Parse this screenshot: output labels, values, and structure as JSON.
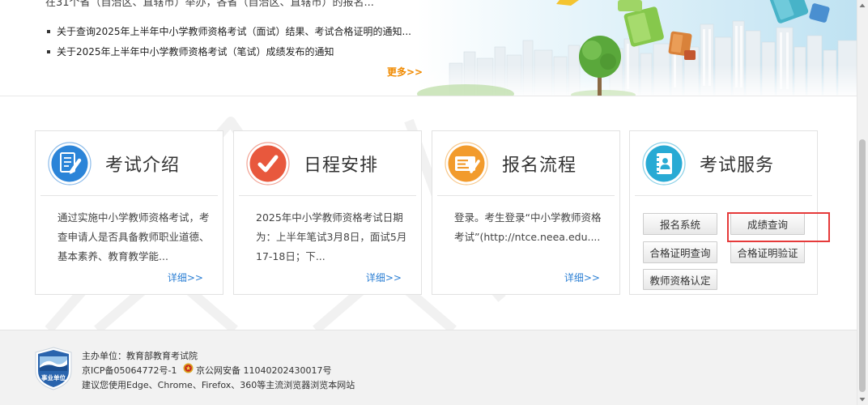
{
  "header": {
    "intro_text": "在31个省（自治区、直辖市）举办，各省（自治区、直辖市）的报名...",
    "news": [
      "关于查询2025年上半年中小学教师资格考试（面试）结果、考试合格证明的通知...",
      "关于2025年上半年中小学教师资格考试（笔试）成绩发布的通知"
    ],
    "more_label": "更多>>"
  },
  "cards": [
    {
      "title": "考试介绍",
      "icon": "document-pencil-icon",
      "color": "#2b84d8",
      "lines": [
        "通过实施中小学教师资格考试，考",
        "查申请人是否具备教师职业道德、",
        "基本素养、教育教学能..."
      ],
      "detail_label": "详细>>"
    },
    {
      "title": "日程安排",
      "icon": "checkmark-icon",
      "color": "#e8583d",
      "lines": [
        "2025年中小学教师资格考试日期",
        "为：上半年笔试3月8日，面试5月",
        "17-18日；下..."
      ],
      "detail_label": "详细>>"
    },
    {
      "title": "报名流程",
      "icon": "registration-form-icon",
      "color": "#f29b2c",
      "lines": [
        "登录。考生登录“中小学教师资格",
        "考试”(http://ntce.neea.edu...."
      ],
      "detail_label": "详细>>"
    },
    {
      "title": "考试服务",
      "icon": "contact-book-icon",
      "color": "#28aad4",
      "buttons": [
        "报名系统",
        "成绩查询",
        "合格证明查询",
        "合格证明验证",
        "教师资格认定"
      ]
    }
  ],
  "highlight_color": "#e53a3a",
  "footer": {
    "logo_text": "事业单位",
    "sponsor": "主办单位：教育部教育考试院",
    "icp": "京ICP备05064772号-1",
    "police_record": "京公网安备 11040202430017号",
    "browser_tip": "建议您使用Edge、Chrome、Firefox、360等主流浏览器浏览本网站"
  }
}
